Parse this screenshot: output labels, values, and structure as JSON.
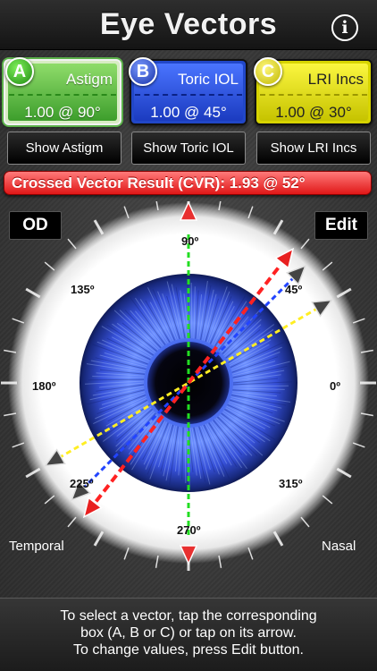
{
  "app": {
    "title": "Eye Vectors",
    "info_glyph": "i"
  },
  "vectors": [
    {
      "badge": "A",
      "label": "Astigm",
      "value": "1.00 @ 90°",
      "color": "#3d9e2c",
      "selected": true
    },
    {
      "badge": "B",
      "label": "Toric IOL",
      "value": "1.00 @ 45°",
      "color": "#1b3bc0"
    },
    {
      "badge": "C",
      "label": "LRI Incs",
      "value": "1.00 @ 30°",
      "color": "#d7d400"
    }
  ],
  "show_buttons": [
    "Show Astigm",
    "Show Toric IOL",
    "Show LRI Incs"
  ],
  "cvr": {
    "text": "Crossed Vector Result (CVR):  1.93 @ 52°",
    "color": "#e01717"
  },
  "eye_side": "OD",
  "edit_label": "Edit",
  "dial": {
    "degree_labels": [
      "90º",
      "45º",
      "0º",
      "315º",
      "270º",
      "225º",
      "180º",
      "135º"
    ],
    "temporal_label": "Temporal",
    "nasal_label": "Nasal",
    "axes": [
      {
        "name": "A",
        "angle_deg": 90,
        "color": "#22dd22"
      },
      {
        "name": "B",
        "angle_deg": 45,
        "color": "#2244ff"
      },
      {
        "name": "C",
        "angle_deg": 30,
        "color": "#ffee22"
      },
      {
        "name": "CVR",
        "angle_deg": 52,
        "color": "#ff2222"
      }
    ]
  },
  "footer": {
    "line1": "To select a vector, tap the corresponding",
    "line2": "box (A, B or C) or tap on its arrow.",
    "line3": "To change values, press Edit button."
  }
}
